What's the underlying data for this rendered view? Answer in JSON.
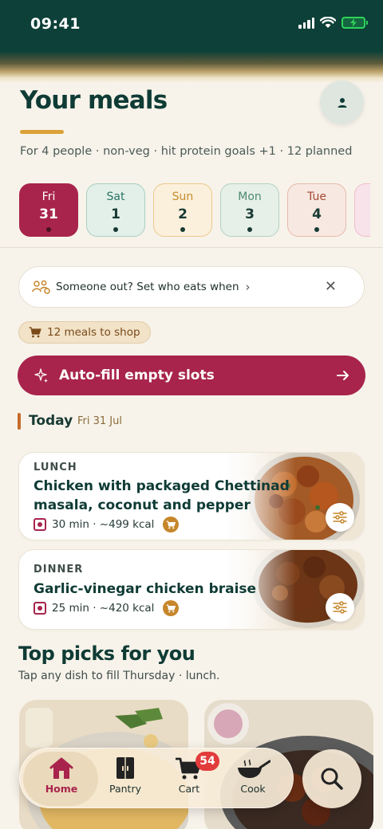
{
  "status": {
    "time": "09:41"
  },
  "header": {
    "title": "Your meals",
    "subtitle": "For 4 people · non-veg · hit protein goals +1 · 12 planned",
    "avatar_icon": "person-icon"
  },
  "days": [
    {
      "name": "Fri",
      "num": "31"
    },
    {
      "name": "Sat",
      "num": "1"
    },
    {
      "name": "Sun",
      "num": "2"
    },
    {
      "name": "Mon",
      "num": "3"
    },
    {
      "name": "Tue",
      "num": "4"
    }
  ],
  "banner": {
    "text": "Someone out? Set who eats when",
    "chevron": "›",
    "close": "✕"
  },
  "shop": {
    "label": "12 meals to shop"
  },
  "autofill": {
    "label": "Auto-fill empty slots"
  },
  "today": {
    "label": "Today",
    "date": "Fri 31 Jul"
  },
  "meals": [
    {
      "slot": "LUNCH",
      "title_line1": "Chicken with packaged Chettinad",
      "title_line2": "masala, coconut and pepper",
      "meta": "30 min · ~499 kcal"
    },
    {
      "slot": "DINNER",
      "title": "Garlic-vinegar chicken braise",
      "meta": "25 min · ~420 kcal"
    }
  ],
  "picks": {
    "title": "Top picks for you",
    "subtitle": "Tap any dish to fill Thursday · lunch."
  },
  "nav": {
    "items": [
      {
        "label": "Home",
        "icon": "home-icon"
      },
      {
        "label": "Pantry",
        "icon": "pantry-icon"
      },
      {
        "label": "Cart",
        "icon": "cart-icon"
      },
      {
        "label": "Cook",
        "icon": "wok-icon"
      }
    ],
    "cart_badge": "54",
    "search_icon": "search-icon"
  },
  "colors": {
    "brand": "#a8244c",
    "header_dark": "#0d4038",
    "accent_gold": "#dca238"
  }
}
